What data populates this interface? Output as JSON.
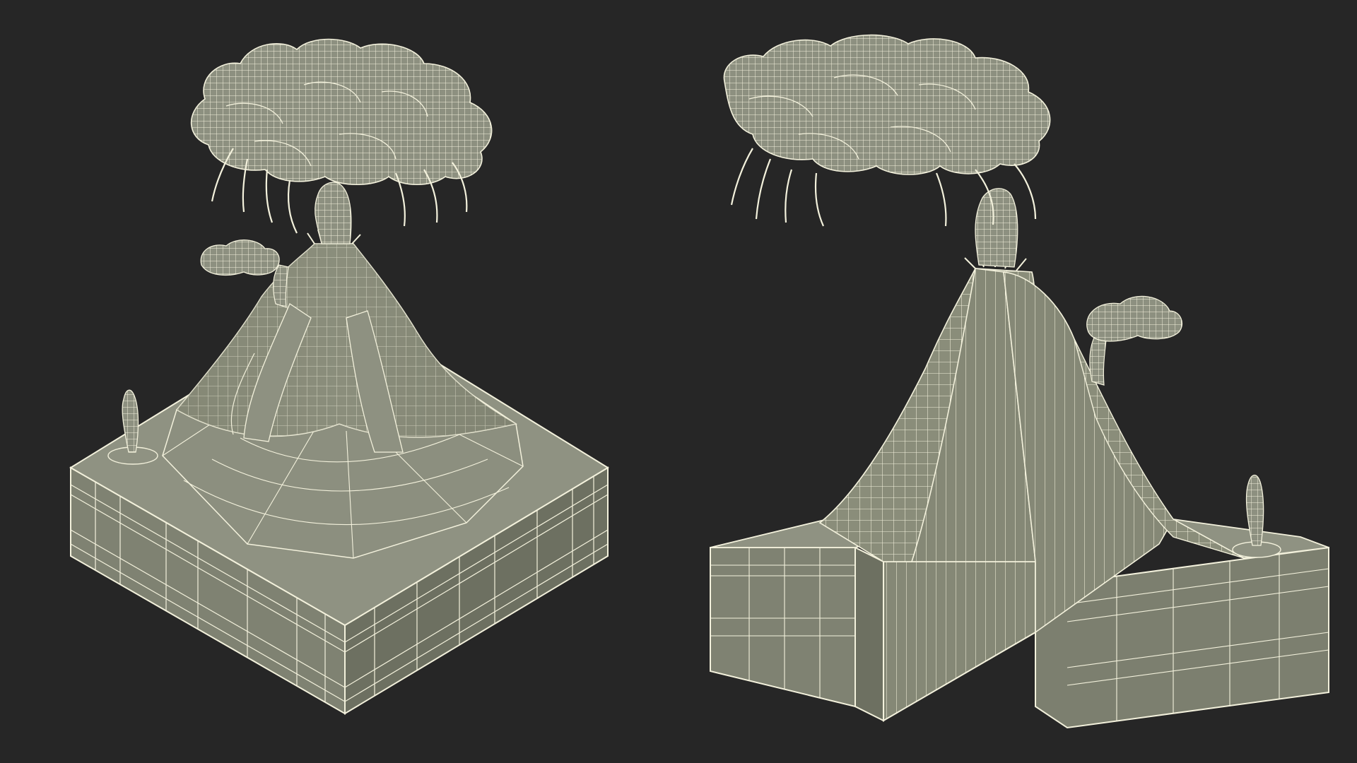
{
  "scene": {
    "background_color": "#262626",
    "model_fill_color": "#8a8d7a",
    "model_shadow_color": "#6f7263",
    "model_light_color": "#a3a694",
    "wire_color": "#f3f1dc"
  },
  "views": [
    {
      "id": "left",
      "subject": "volcano-wireframe-model"
    },
    {
      "id": "right",
      "subject": "volcano-cutaway-wireframe-model"
    }
  ]
}
